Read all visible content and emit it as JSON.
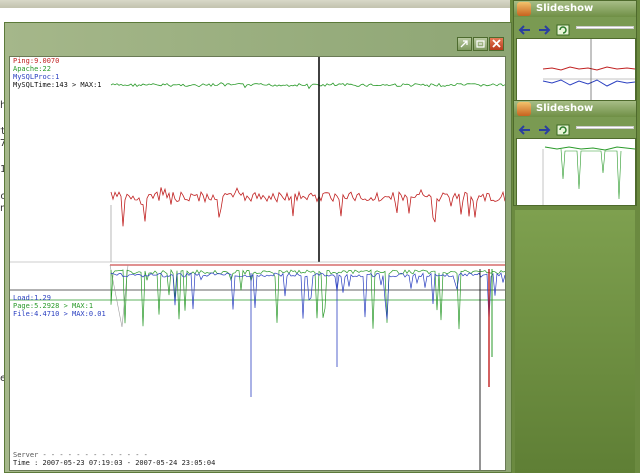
{
  "background": {
    "edge_letters": [
      "h",
      "t",
      "7",
      "1",
      "c",
      "n",
      "e"
    ]
  },
  "dialog": {
    "buttons": [
      {
        "name": "restore-button",
        "icon": "restore-icon"
      },
      {
        "name": "pin-button",
        "icon": "pin-icon"
      },
      {
        "name": "close-button",
        "icon": "close-icon",
        "color": "#d0502c"
      }
    ]
  },
  "graph": {
    "upper_labels": [
      {
        "text": "Ping:9.0070",
        "color": "#c02020"
      },
      {
        "text": "Apache:22",
        "color": "#2a9a2a"
      },
      {
        "text": "MySQLProc:1",
        "color": "#2a3fc0"
      },
      {
        "text": "MySQLTime:143 > MAX:1",
        "color": "#111111"
      }
    ],
    "lower_labels": [
      {
        "text": "Load:1.29",
        "color": "#2a3fc0"
      },
      {
        "text": "Page:5.2928 > MAX:1",
        "color": "#2a9a2a"
      },
      {
        "text": "File:4.4710 > MAX:0.01",
        "color": "#2a3fc0"
      }
    ],
    "footer": {
      "server": "Server - - - - - - - - - - - - -",
      "time": "Time    : 2007-05-23 07:19:03 - 2007-05-24 23:05:04"
    },
    "colors": {
      "ping": "#c02020",
      "apache": "#2a9a2a",
      "mysql": "#2a3fc0",
      "mysqltime": "#111111"
    }
  },
  "sidebar": {
    "panels": [
      {
        "title": "Slideshow"
      },
      {
        "title": "Slideshow"
      }
    ],
    "controls": [
      "back-arrow-icon",
      "forward-arrow-icon",
      "refresh-icon"
    ]
  }
}
